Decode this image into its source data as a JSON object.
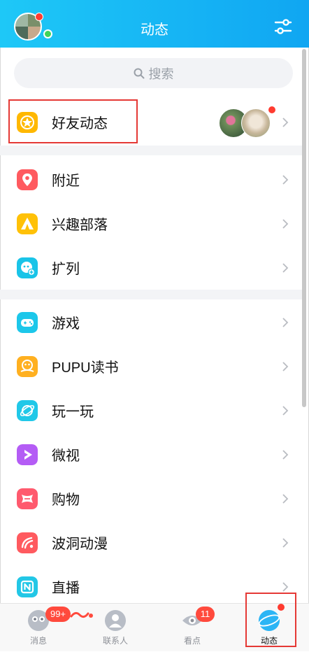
{
  "header": {
    "title": "动态",
    "avatar_icon": "avatar",
    "settings_icon": "sliders-icon"
  },
  "search": {
    "placeholder": "搜索"
  },
  "friends_row": {
    "label": "好友动态",
    "icon": "star-icon",
    "color": "#FFB800"
  },
  "items": [
    {
      "label": "附近",
      "icon": "location-pin-icon",
      "color": "#FF5A5F"
    },
    {
      "label": "兴趣部落",
      "icon": "tent-icon",
      "color": "#FFC107"
    },
    {
      "label": "扩列",
      "icon": "chat-add-icon",
      "color": "#19C4E8"
    },
    {
      "label": "游戏",
      "icon": "gamepad-icon",
      "color": "#1CC7EA"
    },
    {
      "label": "PUPU读书",
      "icon": "book-icon",
      "color": "#FFB020"
    },
    {
      "label": "玩一玩",
      "icon": "planet-icon",
      "color": "#20C8E8"
    },
    {
      "label": "微视",
      "icon": "play-icon",
      "color": "#B45CF5"
    },
    {
      "label": "购物",
      "icon": "bag-icon",
      "color": "#FF5A6E"
    },
    {
      "label": "波洞动漫",
      "icon": "anime-icon",
      "color": "#FF5A5F"
    },
    {
      "label": "直播",
      "icon": "live-icon",
      "color": "#22C7E6"
    }
  ],
  "tabs": [
    {
      "label": "消息",
      "icon": "message-icon",
      "badge": "99+"
    },
    {
      "label": "联系人",
      "icon": "contacts-icon",
      "badge": ""
    },
    {
      "label": "看点",
      "icon": "eye-icon",
      "badge": "11"
    },
    {
      "label": "动态",
      "icon": "dynamic-icon",
      "badge": ""
    }
  ],
  "colors": {
    "header_start": "#1EC8F7",
    "header_end": "#10A6F2",
    "accent_red": "#E53935"
  }
}
